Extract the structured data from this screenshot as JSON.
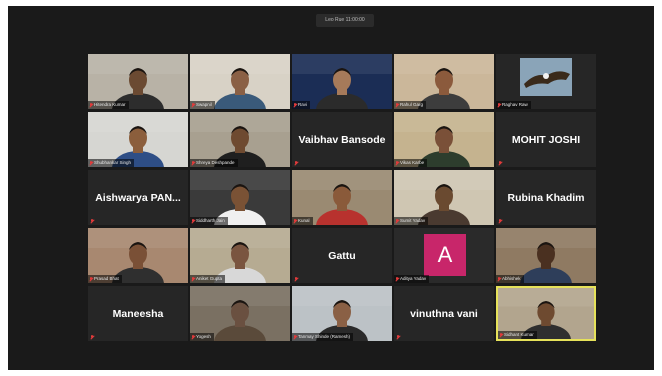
{
  "meeting": {
    "banner": "Leo Rue 11:00:00"
  },
  "participants": [
    {
      "kind": "video",
      "label": "Hitendra Kumar",
      "bg": "#b8b2a6",
      "skin": "#6b4a32",
      "shirt": "#2d2d2d"
    },
    {
      "kind": "video",
      "label": "Swapnil",
      "bg": "#d8d2c6",
      "skin": "#8a6045",
      "shirt": "#3a5a7a"
    },
    {
      "kind": "video",
      "label": "Ravi",
      "bg": "#1b2d55",
      "skin": "#a67a5a",
      "shirt": "#2b2b2b"
    },
    {
      "kind": "video",
      "label": "Rahul Garg",
      "bg": "#cbb79a",
      "skin": "#8b5a3c",
      "shirt": "#3d3d3d"
    },
    {
      "kind": "video",
      "label": "Raghav Raw",
      "bg": "#2a2a2a",
      "skin": "#e0e0e0",
      "shirt": "#3a3a3a",
      "eagle": true
    },
    {
      "kind": "video",
      "label": "Shubhankar Singh",
      "bg": "#d6d6d2",
      "skin": "#8b5e3c",
      "shirt": "#2e4e86"
    },
    {
      "kind": "video",
      "label": "Shreya Deshpande",
      "bg": "#a8a090",
      "skin": "#6e4a30",
      "shirt": "#1f1f1f"
    },
    {
      "kind": "name",
      "name": "Vaibhav Bansode",
      "label": ""
    },
    {
      "kind": "video",
      "label": "Vikas Karbe",
      "bg": "#c5b38f",
      "skin": "#7a5038",
      "shirt": "#2d3d2d"
    },
    {
      "kind": "name",
      "name": "MOHIT JOSHI",
      "label": ""
    },
    {
      "kind": "name",
      "name": "Aishwarya PAN...",
      "label": ""
    },
    {
      "kind": "video",
      "label": "Siddharth Jain",
      "bg": "#3a3a3a",
      "skin": "#7a5235",
      "shirt": "#f0f0f0"
    },
    {
      "kind": "video",
      "label": "Kunal",
      "bg": "#9a8a72",
      "skin": "#8a5a3a",
      "shirt": "#b8322e"
    },
    {
      "kind": "video",
      "label": "Sumit Yadav",
      "bg": "#cfc6b2",
      "skin": "#6a4a30",
      "shirt": "#4a3a30"
    },
    {
      "kind": "name",
      "name": "Rubina Khadim",
      "label": ""
    },
    {
      "kind": "video",
      "label": "Prasad Bhat",
      "bg": "#a88870",
      "skin": "#7a5036",
      "shirt": "#2f2f2f"
    },
    {
      "kind": "video",
      "label": "Aniket Gupta",
      "bg": "#b6ab92",
      "skin": "#7a5540",
      "shirt": "#d8d8d8"
    },
    {
      "kind": "name",
      "name": "Gattu",
      "label": ""
    },
    {
      "kind": "avatar",
      "letter": "A",
      "label": "Aditya Yadav"
    },
    {
      "kind": "video",
      "label": "Abhishek",
      "bg": "#8f7a62",
      "skin": "#4a3020",
      "shirt": "#2e3e5a"
    },
    {
      "kind": "name",
      "name": "Maneesha",
      "label": ""
    },
    {
      "kind": "video",
      "label": "Yogesh",
      "bg": "#7a7062",
      "skin": "#6a5040",
      "shirt": "#5a4a3a"
    },
    {
      "kind": "video",
      "label": "Tanmay Shinde (Ramesh)",
      "bg": "#bcc2c6",
      "skin": "#8a6045",
      "shirt": "#2a2a2a"
    },
    {
      "kind": "name",
      "name": "vinuthna vani",
      "label": ""
    },
    {
      "kind": "video",
      "label": "Sidhant Kumar",
      "bg": "#b2a58e",
      "skin": "#6e4a30",
      "shirt": "#2f2f2f",
      "active": true
    }
  ]
}
